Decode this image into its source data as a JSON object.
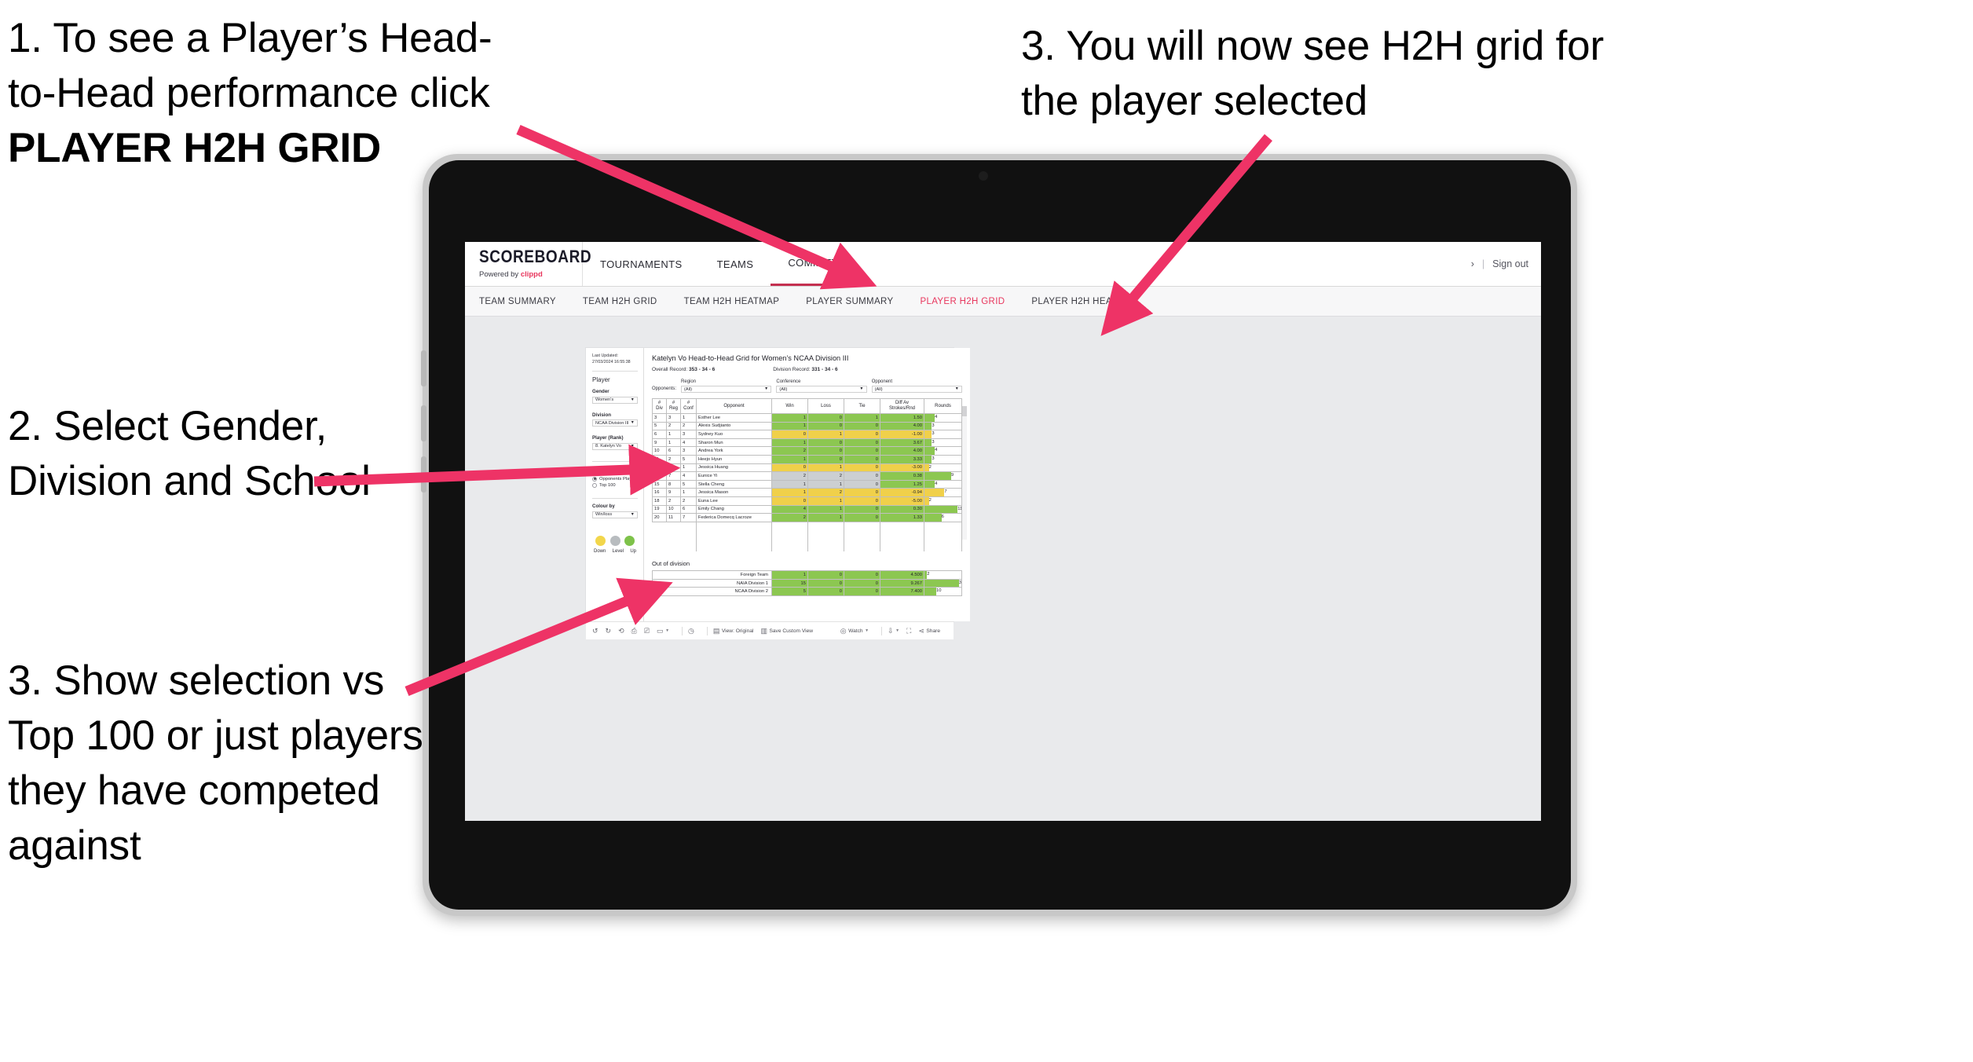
{
  "annotations": {
    "a1_line1": "1. To see a Player’s Head-",
    "a1_line2": "to-Head performance click",
    "a1_bold": "PLAYER H2H GRID",
    "a2": "2. Select Gender, Division and School",
    "a3": "3. Show selection vs Top 100 or just players they have competed against",
    "a4": "3. You will now see H2H grid for the player selected"
  },
  "brand": {
    "logo_title": "SCOREBOARD",
    "powered_by": "Powered by",
    "brand_name": "clippd",
    "accent": "#e8365d",
    "active_tab_underline": "#c43050"
  },
  "header": {
    "nav": [
      {
        "label": "TOURNAMENTS",
        "active": false
      },
      {
        "label": "TEAMS",
        "active": false
      },
      {
        "label": "COMMITTEE",
        "active": true
      }
    ],
    "account_chevron": "›",
    "separator": "|",
    "sign_out": "Sign out"
  },
  "subnav": {
    "items": [
      {
        "label": "TEAM SUMMARY",
        "active": false
      },
      {
        "label": "TEAM H2H GRID",
        "active": false
      },
      {
        "label": "TEAM H2H HEATMAP",
        "active": false
      },
      {
        "label": "PLAYER SUMMARY",
        "active": false
      },
      {
        "label": "PLAYER H2H GRID",
        "active": true
      },
      {
        "label": "PLAYER H2H HEATMAP",
        "active": false
      }
    ]
  },
  "filter_panel": {
    "last_updated": "Last Updated: 27/03/2024 16:55:38",
    "section_player": "Player",
    "gender_label": "Gender",
    "gender_value": "Women’s",
    "division_label": "Division",
    "division_value": "NCAA Division III",
    "player_label": "Player (Rank)",
    "player_value": "8. Katelyn Vo",
    "opponent_view_label": "Opponent view",
    "opponent_view_options": [
      {
        "label": "Opponents Played",
        "selected": true
      },
      {
        "label": "Top 100",
        "selected": false
      }
    ],
    "colour_by_label": "Colour by",
    "colour_by_value": "Win/loss",
    "legend": [
      {
        "label": "Down",
        "color": "#f2d64b"
      },
      {
        "label": "Level",
        "color": "#b8bcbf"
      },
      {
        "label": "Up",
        "color": "#7ec24a"
      }
    ]
  },
  "viz": {
    "title": "Katelyn Vo Head-to-Head Grid for Women’s NCAA Division III",
    "overall_record_label": "Overall Record:",
    "overall_record_value": "353 -  34 - 6",
    "division_record_label": "Division Record:",
    "division_record_value": "331 -  34 - 6",
    "opponents_label": "Opponents:",
    "filters": [
      {
        "caption": "Region",
        "value": "(All)"
      },
      {
        "caption": "Conference",
        "value": "(All)"
      },
      {
        "caption": "Opponent",
        "value": "(All)"
      }
    ],
    "out_of_division_title": "Out of division"
  },
  "chart_data": {
    "type": "table",
    "title": "Katelyn Vo Head-to-Head Grid for Women’s NCAA Division III",
    "columns": [
      "# Div",
      "# Reg",
      "# Conf",
      "Opponent",
      "Win",
      "Loss",
      "Tie",
      "Diff Av Strokes/Rnd",
      "Rounds"
    ],
    "column_header_lines": [
      [
        "#",
        "Div"
      ],
      [
        "#",
        "Reg"
      ],
      [
        "#",
        "Conf"
      ],
      [
        "Opponent"
      ],
      [
        "Win"
      ],
      [
        "Loss"
      ],
      [
        "Tie"
      ],
      [
        "Diff Av",
        "Strokes/Rnd"
      ],
      [
        "Rounds"
      ]
    ],
    "rows": [
      {
        "div": "3",
        "reg": "3",
        "conf": "1",
        "opponent": "Esther Lee",
        "win": "1",
        "loss": "0",
        "tie": "1",
        "diff": "1.50",
        "rounds": "4",
        "color": "#8cc751",
        "rounds_frac": 0.28
      },
      {
        "div": "5",
        "reg": "2",
        "conf": "2",
        "opponent": "Alexis Sudjianto",
        "win": "1",
        "loss": "0",
        "tie": "0",
        "diff": "4.00",
        "rounds": "3",
        "color": "#8cc751",
        "rounds_frac": 0.2
      },
      {
        "div": "6",
        "reg": "1",
        "conf": "3",
        "opponent": "Sydney Kuo",
        "win": "0",
        "loss": "1",
        "tie": "0",
        "diff": "-1.00",
        "rounds": "3",
        "color": "#f0d04a",
        "rounds_frac": 0.2
      },
      {
        "div": "9",
        "reg": "1",
        "conf": "4",
        "opponent": "Sharon Mun",
        "win": "1",
        "loss": "0",
        "tie": "0",
        "diff": "3.67",
        "rounds": "3",
        "color": "#8cc751",
        "rounds_frac": 0.2
      },
      {
        "div": "10",
        "reg": "6",
        "conf": "3",
        "opponent": "Andrea York",
        "win": "2",
        "loss": "0",
        "tie": "0",
        "diff": "4.00",
        "rounds": "4",
        "color": "#8cc751",
        "rounds_frac": 0.28
      },
      {
        "div": "11",
        "reg": "2",
        "conf": "5",
        "opponent": "Heejo Hyun",
        "win": "1",
        "loss": "0",
        "tie": "0",
        "diff": "3.33",
        "rounds": "3",
        "color": "#8cc751",
        "rounds_frac": 0.2
      },
      {
        "div": "13",
        "reg": "1",
        "conf": "1",
        "opponent": "Jessica Huang",
        "win": "0",
        "loss": "1",
        "tie": "0",
        "diff": "-3.00",
        "rounds": "2",
        "color": "#f0d04a",
        "rounds_frac": 0.12
      },
      {
        "div": "14",
        "reg": "7",
        "conf": "4",
        "opponent": "Eunice Yi",
        "win": "2",
        "loss": "2",
        "tie": "0",
        "diff": "0.38",
        "rounds": "9",
        "color": "#cccfd1",
        "diff_color": "#8cc751",
        "rounds_frac": 0.72
      },
      {
        "div": "15",
        "reg": "8",
        "conf": "5",
        "opponent": "Stella Cheng",
        "win": "1",
        "loss": "1",
        "tie": "0",
        "diff": "1.25",
        "rounds": "4",
        "color": "#cccfd1",
        "diff_color": "#8cc751",
        "rounds_frac": 0.28
      },
      {
        "div": "16",
        "reg": "9",
        "conf": "1",
        "opponent": "Jessica Mason",
        "win": "1",
        "loss": "2",
        "tie": "0",
        "diff": "-0.94",
        "rounds": "7",
        "color": "#f0d04a",
        "rounds_frac": 0.54
      },
      {
        "div": "18",
        "reg": "2",
        "conf": "2",
        "opponent": "Euna Lee",
        "win": "0",
        "loss": "1",
        "tie": "0",
        "diff": "-5.00",
        "rounds": "2",
        "color": "#f0d04a",
        "rounds_frac": 0.12
      },
      {
        "div": "19",
        "reg": "10",
        "conf": "6",
        "opponent": "Emily Chang",
        "win": "4",
        "loss": "1",
        "tie": "0",
        "diff": "0.30",
        "rounds": "11",
        "color": "#8cc751",
        "rounds_frac": 0.9
      },
      {
        "div": "20",
        "reg": "11",
        "conf": "7",
        "opponent": "Federica Domecq Lacroze",
        "win": "2",
        "loss": "1",
        "tie": "0",
        "diff": "1.33",
        "rounds": "6",
        "color": "#8cc751",
        "rounds_frac": 0.46
      }
    ],
    "out_of_division": {
      "title": "Out of division",
      "rows": [
        {
          "opponent": "Foreign Team",
          "win": "1",
          "loss": "0",
          "tie": "0",
          "diff": "4.500",
          "rounds": "2",
          "color": "#8cc751",
          "rounds_frac": 0.07
        },
        {
          "opponent": "NAIA Division 1",
          "win": "15",
          "loss": "0",
          "tie": "0",
          "diff": "9.267",
          "rounds": "30",
          "color": "#8cc751",
          "rounds_frac": 0.93
        },
        {
          "opponent": "NCAA Division 2",
          "win": "5",
          "loss": "0",
          "tie": "0",
          "diff": "7.400",
          "rounds": "10",
          "color": "#8cc751",
          "rounds_frac": 0.32
        }
      ]
    }
  },
  "toolbar": {
    "undo": "undo-icon",
    "redo": "redo-icon",
    "revert": "revert-icon",
    "refresh": "refresh-icon",
    "pause": "pause-icon",
    "dashboard_dd": "dashboard-dropdown-icon",
    "clock": "clock-icon",
    "view_original": "View: Original",
    "save_custom_view": "Save Custom View",
    "watch": "Watch",
    "download": "download-icon",
    "fullscreen": "fullscreen-icon",
    "share": "Share"
  }
}
